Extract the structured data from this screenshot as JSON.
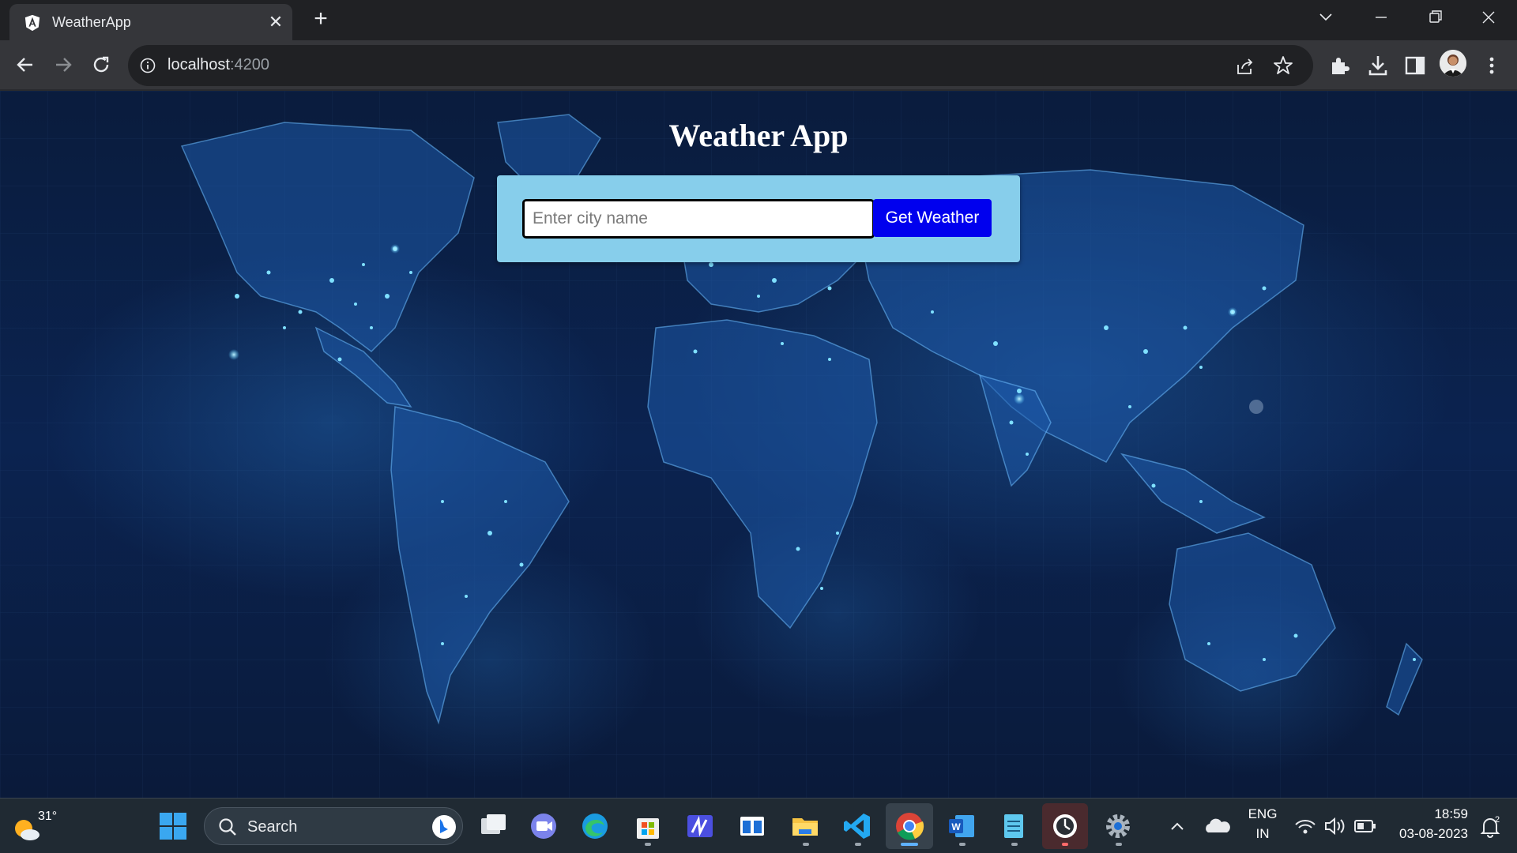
{
  "browser": {
    "tab_title": "WeatherApp",
    "url_host": "localhost",
    "url_port": ":4200"
  },
  "app": {
    "title": "Weather App",
    "input_placeholder": "Enter city name",
    "input_value": "",
    "button_label": "Get Weather"
  },
  "taskbar": {
    "weather_temp": "31°",
    "search_label": "Search",
    "lang_top": "ENG",
    "lang_bottom": "IN",
    "time": "18:59",
    "date": "03-08-2023",
    "notification_count": "2"
  },
  "colors": {
    "card_bg": "#87ceeb",
    "button_bg": "#0000ee",
    "map_bg": "#0b2350",
    "chrome_dark": "#202124",
    "chrome_toolbar": "#35363a"
  }
}
